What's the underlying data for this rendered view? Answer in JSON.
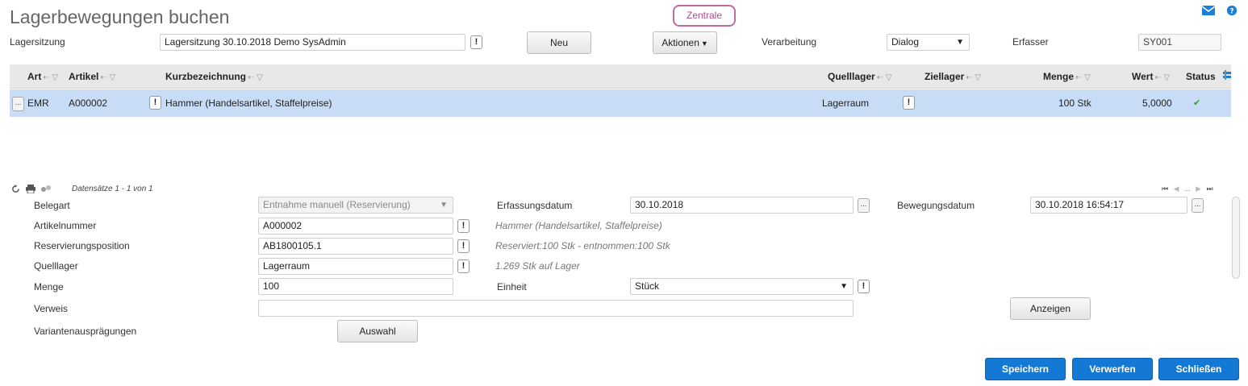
{
  "page": {
    "title": "Lagerbewegungen buchen",
    "tenant": "Zentrale",
    "icons": {
      "mail": "mail-icon",
      "help": "help-icon"
    }
  },
  "header": {
    "session_label": "Lagersitzung",
    "session_value": "Lagersitzung 30.10.2018 Demo SysAdmin",
    "new_button": "Neu",
    "actions_button": "Aktionen",
    "processing_label": "Verarbeitung",
    "processing_value": "Dialog",
    "recorder_label": "Erfasser",
    "recorder_value": "SY001"
  },
  "grid": {
    "columns": [
      "Art",
      "Artikel",
      "Kurzbezeichnung",
      "Quelllager",
      "Ziellager",
      "Menge",
      "Wert",
      "Status"
    ],
    "rows": [
      {
        "art": "EMR",
        "artikel": "A000002",
        "kurzbezeichnung": "Hammer (Handelsartikel, Staffelpreise)",
        "quelllager": "Lagerraum",
        "ziellager": "",
        "menge": "100 Stk",
        "wert": "5,0000",
        "status": "✔"
      }
    ],
    "row_menu": "...",
    "excl": "!"
  },
  "nav": {
    "records": "Datensätze 1 - 1 von 1",
    "pager_dots": "..."
  },
  "form": {
    "belegart_label": "Belegart",
    "belegart_value": "Entnahme manuell (Reservierung)",
    "erfassungsdatum_label": "Erfassungsdatum",
    "erfassungsdatum_value": "30.10.2018",
    "bewegungsdatum_label": "Bewegungsdatum",
    "bewegungsdatum_value": "30.10.2018 16:54:17",
    "artikelnummer_label": "Artikelnummer",
    "artikelnummer_value": "A000002",
    "artikel_hint": "Hammer (Handelsartikel, Staffelpreise)",
    "reservierung_label": "Reservierungsposition",
    "reservierung_value": "AB1800105.1",
    "reservierung_hint": "Reserviert:100 Stk - entnommen:100 Stk",
    "quelllager_label": "Quelllager",
    "quelllager_value": "Lagerraum",
    "quelllager_hint": "1.269 Stk auf Lager",
    "menge_label": "Menge",
    "menge_value": "100",
    "einheit_label": "Einheit",
    "einheit_value": "Stück",
    "verweis_label": "Verweis",
    "verweis_value": "",
    "anzeigen_button": "Anzeigen",
    "varianten_label": "Variantenausprägungen",
    "auswahl_button": "Auswahl"
  },
  "footer": {
    "save": "Speichern",
    "discard": "Verwerfen",
    "close": "Schließen"
  },
  "colors": {
    "accent": "#1479d4",
    "tenant_border": "#c06b9c",
    "selected_row": "#c8dcf6",
    "header_bg": "#e8e8e8",
    "status_ok": "#2e9e2e"
  }
}
